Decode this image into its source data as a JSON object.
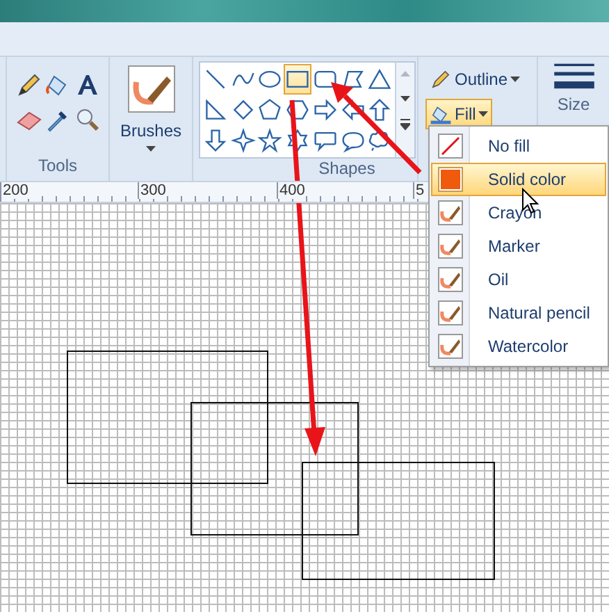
{
  "ribbon": {
    "tools": {
      "label": "Tools"
    },
    "brushes": {
      "label": "Brushes"
    },
    "shapes": {
      "label": "Shapes",
      "items": [
        {
          "kind": "line",
          "selected": false
        },
        {
          "kind": "curve",
          "selected": false
        },
        {
          "kind": "oval",
          "selected": false
        },
        {
          "kind": "rectangle",
          "selected": true
        },
        {
          "kind": "rounded-rectangle",
          "selected": false
        },
        {
          "kind": "polygon",
          "selected": false
        },
        {
          "kind": "triangle",
          "selected": false
        },
        {
          "kind": "right-triangle",
          "selected": false
        },
        {
          "kind": "diamond",
          "selected": false
        },
        {
          "kind": "pentagon",
          "selected": false
        },
        {
          "kind": "hexagon",
          "selected": false
        },
        {
          "kind": "arrow-right",
          "selected": false
        },
        {
          "kind": "arrow-left",
          "selected": false
        },
        {
          "kind": "arrow-up",
          "selected": false
        },
        {
          "kind": "arrow-down",
          "selected": false
        },
        {
          "kind": "star4",
          "selected": false
        },
        {
          "kind": "star5",
          "selected": false
        },
        {
          "kind": "star6",
          "selected": false
        },
        {
          "kind": "callout-rect",
          "selected": false
        },
        {
          "kind": "callout-oval",
          "selected": false
        },
        {
          "kind": "callout-cloud",
          "selected": false
        }
      ]
    },
    "outline": {
      "label": "Outline",
      "selected": false
    },
    "fill": {
      "label": "Fill",
      "selected": true
    },
    "size": {
      "label": "Size"
    }
  },
  "ruler": [
    "200",
    "300",
    "400",
    "5"
  ],
  "fill_menu": [
    {
      "label": "No fill",
      "kind": "none",
      "selected": false
    },
    {
      "label": "Solid color",
      "kind": "solid",
      "selected": true
    },
    {
      "label": "Crayon",
      "kind": "brush",
      "selected": false
    },
    {
      "label": "Marker",
      "kind": "brush",
      "selected": false
    },
    {
      "label": "Oil",
      "kind": "brush",
      "selected": false
    },
    {
      "label": "Natural pencil",
      "kind": "brush",
      "selected": false
    },
    {
      "label": "Watercolor",
      "kind": "brush",
      "selected": false
    }
  ]
}
